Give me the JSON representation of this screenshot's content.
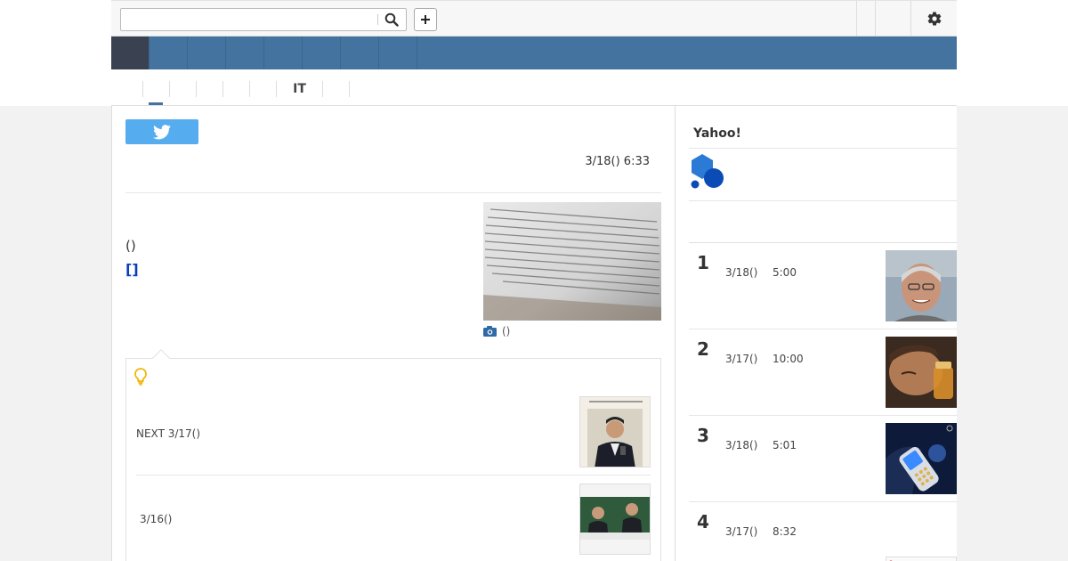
{
  "search": {
    "placeholder": ""
  },
  "icons": {
    "search": "search-icon",
    "add": "plus-icon",
    "settings": "gear-icon",
    "twitter": "twitter-bird-icon",
    "camera": "camera-icon",
    "tip": "lightbulb-icon",
    "logo": "hexagon-dots-logo"
  },
  "colors": {
    "nav_blue": "#44739f",
    "nav_active": "#3a4150",
    "twitter": "#55acee",
    "link": "#0b3fb9",
    "bulb": "#f0b400",
    "logo_light": "#2b7ad6",
    "logo_dark": "#0b4bb5"
  },
  "subnav": {
    "items": [
      "",
      "",
      "",
      "",
      "",
      "IT",
      "",
      ""
    ]
  },
  "article": {
    "date": "3/18() 6:33",
    "lead_text": "()",
    "lead_link": "[]",
    "photo_credit": "()"
  },
  "related": {
    "items": [
      {
        "label": "NEXT 3/17()"
      },
      {
        "label": "3/16()"
      }
    ]
  },
  "sidebar": {
    "title": "Yahoo!",
    "ranking": [
      {
        "rank": "1",
        "date": "3/18()",
        "time": "5:00"
      },
      {
        "rank": "2",
        "date": "3/17()",
        "time": "10:00"
      },
      {
        "rank": "3",
        "date": "3/18()",
        "time": "5:01"
      },
      {
        "rank": "4",
        "date": "3/17()",
        "time": "8:32"
      }
    ]
  }
}
